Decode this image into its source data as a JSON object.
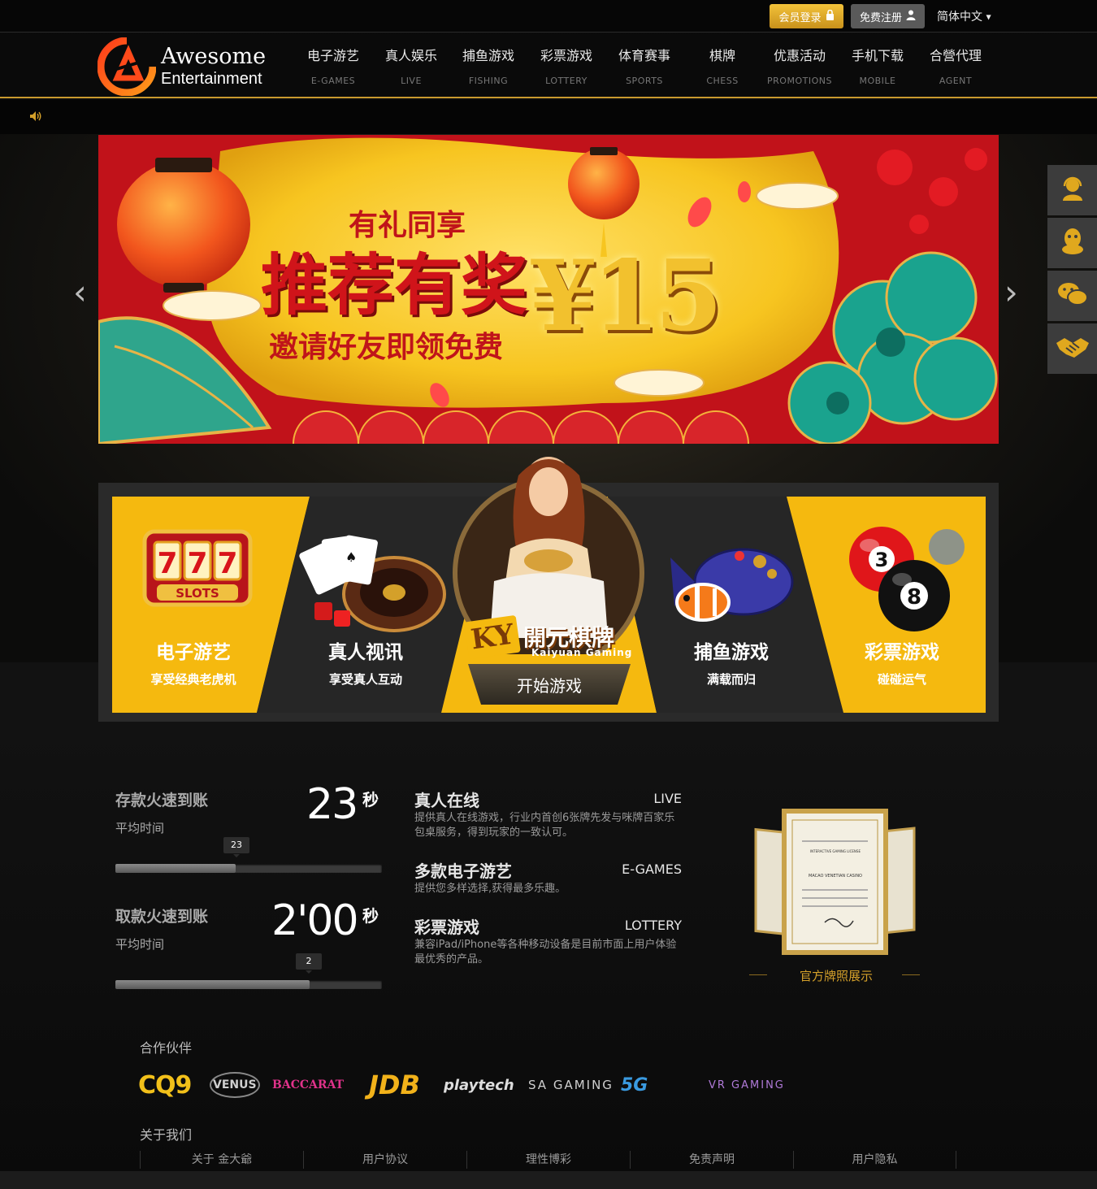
{
  "topbar": {
    "login_label": "会员登录",
    "register_label": "免费注册",
    "language": "简体中文"
  },
  "logo": {
    "line1": "Awesome",
    "line2": "Entertainment"
  },
  "nav": [
    {
      "cn": "电子游艺",
      "en": "E-GAMES"
    },
    {
      "cn": "真人娱乐",
      "en": "LIVE"
    },
    {
      "cn": "捕鱼游戏",
      "en": "FISHING"
    },
    {
      "cn": "彩票游戏",
      "en": "LOTTERY"
    },
    {
      "cn": "体育赛事",
      "en": "SPORTS"
    },
    {
      "cn": "棋牌",
      "en": "CHESS"
    },
    {
      "cn": "优惠活动",
      "en": "PROMOTIONS"
    },
    {
      "cn": "手机下载",
      "en": "MOBILE"
    },
    {
      "cn": "合營代理",
      "en": "AGENT"
    }
  ],
  "banner": {
    "line1": "有礼同享",
    "line2": "推荐有奖",
    "line3": "邀请好友即领免费",
    "amount": "¥15"
  },
  "side_widgets": [
    "customer-service-icon",
    "qq-icon",
    "wechat-icon",
    "handshake-icon"
  ],
  "games": [
    {
      "title": "电子游艺",
      "sub": "享受经典老虎机",
      "image_text": "777 SLOTS"
    },
    {
      "title": "真人视讯",
      "sub": "享受真人互动"
    },
    {
      "title": "開元棋牌",
      "sub": "Kaiyuan Gaming",
      "badge": "KY",
      "button": "开始游戏"
    },
    {
      "title": "捕鱼游戏",
      "sub": "满载而归"
    },
    {
      "title": "彩票游戏",
      "sub": "碰碰运气",
      "balls": [
        "3",
        "8"
      ]
    }
  ],
  "stats": [
    {
      "title": "存款火速到账",
      "sub": "平均时间",
      "value": "23",
      "unit": "秒",
      "tip": "23",
      "fill_fraction": 0.45
    },
    {
      "title": "取款火速到账",
      "sub": "平均时间",
      "value": "2'00",
      "unit": "秒",
      "tip": "2",
      "fill_fraction": 0.73
    }
  ],
  "features": [
    {
      "title": "真人在线",
      "en": "LIVE",
      "desc": "提供真人在线游戏，行业内首创6张牌先发与咪牌百家乐包桌服务，得到玩家的一致认可。"
    },
    {
      "title": "多款电子游艺",
      "en": "E-GAMES",
      "desc": "提供您多样选择,获得最多乐趣。"
    },
    {
      "title": "彩票游戏",
      "en": "LOTTERY",
      "desc": "兼容iPad/iPhone等各种移动设备是目前市面上用户体验最优秀的产品。"
    }
  ],
  "license": {
    "caption": "官方牌照展示",
    "cert_line1": "INTERACTIVE GAMING LICENSE",
    "cert_line2": "MACAO VENETIAN CASINO"
  },
  "partners_title": "合作伙伴",
  "partners": [
    "CQ9",
    "VENUS",
    "BACCARAT",
    "JDB",
    "playtech",
    "SA GAMING",
    "5G",
    "VR GAMING"
  ],
  "about_title": "关于我们",
  "footer_links": [
    "关于 金大爺",
    "用户协议",
    "理性博彩",
    "免责声明",
    "用户隐私"
  ],
  "colors": {
    "gold": "#d4a02a",
    "yellow_panel": "#f5b90f",
    "dark": "#0a0a0a",
    "banner_red": "#b3131a"
  }
}
